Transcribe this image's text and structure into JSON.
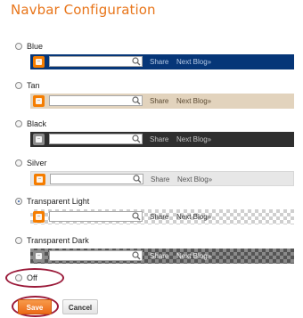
{
  "dialog": {
    "title": "Navbar Configuration"
  },
  "options": [
    {
      "label": "Blue",
      "checked": false
    },
    {
      "label": "Tan",
      "checked": false
    },
    {
      "label": "Black",
      "checked": false
    },
    {
      "label": "Silver",
      "checked": false
    },
    {
      "label": "Transparent Light",
      "checked": true
    },
    {
      "label": "Transparent Dark",
      "checked": false
    },
    {
      "label": "Off",
      "checked": false
    }
  ],
  "navbar_preview": {
    "share_label": "Share",
    "next_blog_label": "Next Blog»"
  },
  "buttons": {
    "save_label": "Save",
    "cancel_label": "Cancel"
  },
  "colors": {
    "title": "#e8751a",
    "blue_bar": "#063678",
    "tan_bar": "#e2d3bd",
    "black_bar": "#2f2f2f",
    "silver_bar": "#e7e7e7",
    "save_button": "#f0782a",
    "highlight_ellipse": "#9b1b3a"
  },
  "icons": [
    "blogger-logo-icon",
    "magnifier-icon",
    "radio-button-icon"
  ]
}
